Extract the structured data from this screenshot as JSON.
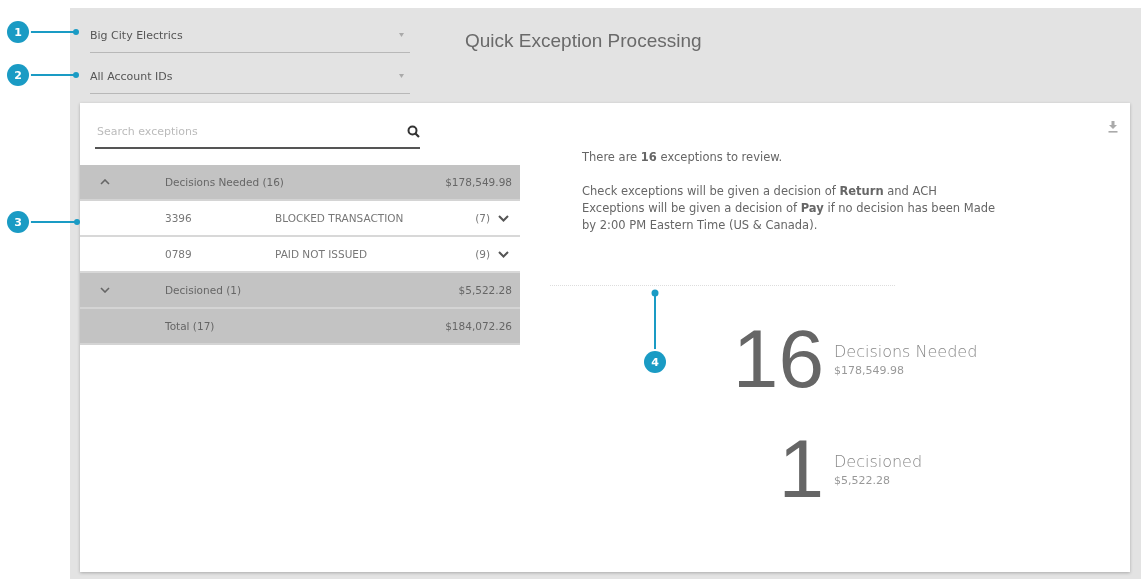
{
  "callouts": [
    {
      "number": "1",
      "kind": "horizontal"
    },
    {
      "number": "2",
      "kind": "horizontal"
    },
    {
      "number": "3",
      "kind": "horizontal"
    },
    {
      "number": "4",
      "kind": "vertical"
    }
  ],
  "filters": [
    {
      "value": "Big City Electrics"
    },
    {
      "value": "All Account IDs"
    }
  ],
  "title": "Quick Exception Processing",
  "search": {
    "placeholder": "Search exceptions"
  },
  "summary": {
    "groups": [
      {
        "label": "Decisions Needed (16)",
        "amount": "$178,549.98",
        "expanded": true,
        "rows": [
          {
            "account": "3396",
            "type": "BLOCKED TRANSACTION",
            "count": "(7)",
            "expanded": false
          },
          {
            "account": "0789",
            "type": "PAID NOT ISSUED",
            "count": "(9)",
            "expanded": false
          }
        ]
      },
      {
        "label": "Decisioned (1)",
        "amount": "$5,522.28",
        "expanded": false
      }
    ],
    "total": {
      "label": "Total (17)",
      "amount": "$184,072.26"
    }
  },
  "message": [
    "There are **16** exceptions to review.",
    "Check exceptions will be given a decision of **Return** and ACH Exceptions will be given a decision of **Pay** if no decision has been Made by 2:00 PM Eastern Time (US & Canada)."
  ],
  "stats": [
    {
      "count": "16",
      "label": "Decisions Needed",
      "amount": "$178,549.98"
    },
    {
      "count": "1",
      "label": "Decisioned",
      "amount": "$5,522.28"
    }
  ]
}
